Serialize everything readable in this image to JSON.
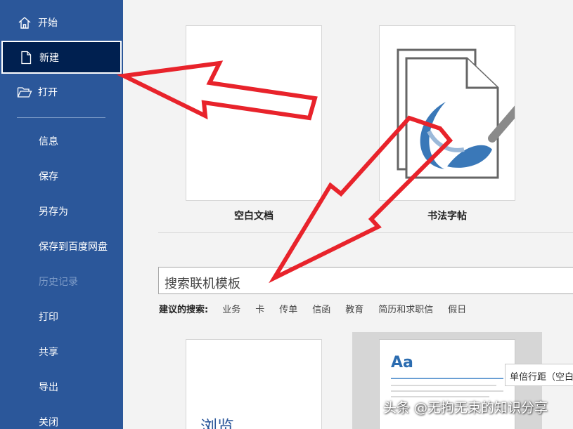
{
  "sidebar": {
    "items": [
      {
        "label": "开始",
        "icon": "home-icon"
      },
      {
        "label": "新建",
        "icon": "new-document-icon",
        "selected": true
      },
      {
        "label": "打开",
        "icon": "open-folder-icon"
      },
      {
        "label": "信息"
      },
      {
        "label": "保存"
      },
      {
        "label": "另存为"
      },
      {
        "label": "保存到百度网盘"
      },
      {
        "label": "历史记录",
        "disabled": true
      },
      {
        "label": "打印"
      },
      {
        "label": "共享"
      },
      {
        "label": "导出"
      },
      {
        "label": "关闭"
      }
    ],
    "colors": {
      "background": "#2b579a",
      "selected": "#002050"
    }
  },
  "templates": {
    "blank": {
      "label": "空白文档"
    },
    "calligraphy": {
      "label": "书法字帖"
    }
  },
  "search": {
    "placeholder": "搜索联机模板"
  },
  "suggested": {
    "label": "建议的搜索:",
    "links": [
      "业务",
      "卡",
      "传单",
      "信函",
      "教育",
      "简历和求职信",
      "假日"
    ]
  },
  "bottom_templates": {
    "browse_text": "浏览",
    "styles_text": "Aa",
    "tooltip": "单倍行距（空白）"
  },
  "annotation": {
    "color": "#e8232b"
  },
  "watermark": "头条 @无拘无束的知识分享"
}
